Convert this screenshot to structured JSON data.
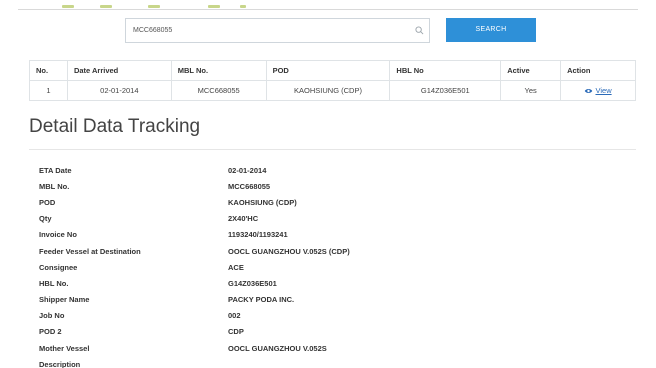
{
  "search": {
    "value": "MCC668055",
    "button_label": "SEARCH"
  },
  "results": {
    "headers": [
      "No.",
      "Date Arrived",
      "MBL No.",
      "POD",
      "HBL No",
      "Active",
      "Action"
    ],
    "rows": [
      {
        "no": "1",
        "date_arrived": "02-01-2014",
        "mbl_no": "MCC668055",
        "pod": "KAOHSIUNG (CDP)",
        "hbl_no": "G14Z036E501",
        "active": "Yes",
        "action_label": "View"
      }
    ]
  },
  "detail": {
    "title": "Detail Data Tracking",
    "fields": [
      {
        "label": "ETA Date",
        "value": "02-01-2014"
      },
      {
        "label": "MBL No.",
        "value": "MCC668055"
      },
      {
        "label": "POD",
        "value": "KAOHSIUNG (CDP)"
      },
      {
        "label": "Qty",
        "value": "2X40'HC"
      },
      {
        "label": "Invoice No",
        "value": "1193240/1193241"
      },
      {
        "label": "Feeder Vessel at Destination",
        "value": "OOCL GUANGZHOU V.052S (CDP)"
      },
      {
        "label": "Consignee",
        "value": "ACE"
      },
      {
        "label": "HBL No.",
        "value": "G14Z036E501"
      },
      {
        "label": "Shipper Name",
        "value": "PACKY PODA INC."
      },
      {
        "label": "Job No",
        "value": "002"
      },
      {
        "label": "POD 2",
        "value": "CDP"
      },
      {
        "label": "Mother Vessel",
        "value": "OOCL GUANGZHOU V.052S"
      },
      {
        "label": "Description",
        "value": ""
      }
    ]
  },
  "colors": {
    "accent": "#2e90d8",
    "link": "#2a6ab8",
    "border": "#dfe3e6"
  },
  "icons": {
    "search": "search-icon",
    "view": "eye-icon"
  }
}
